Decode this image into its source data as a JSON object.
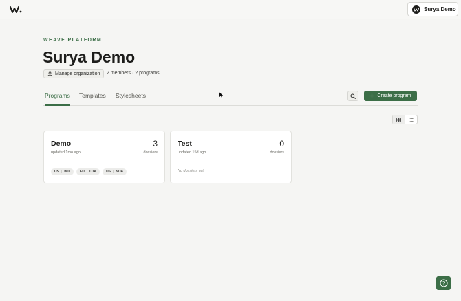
{
  "topbar": {
    "logo_icon": "weave-logo-icon",
    "user_label": "Surya Demo"
  },
  "header": {
    "eyebrow": "WEAVE PLATFORM",
    "title": "Surya Demo",
    "manage_label": "Manage organization",
    "meta": "2 members · 2 programs"
  },
  "tabs": [
    {
      "label": "Programs",
      "active": true
    },
    {
      "label": "Templates",
      "active": false
    },
    {
      "label": "Stylesheets",
      "active": false
    }
  ],
  "actions": {
    "search_icon": "search-icon",
    "create_label": "Create program"
  },
  "view_toggle": {
    "options": [
      "grid-view-icon",
      "list-view-icon"
    ],
    "selected": "grid-view-icon"
  },
  "programs": [
    {
      "name": "Demo",
      "count": "3",
      "updated": "updated 1mo ago",
      "unit": "dossiers",
      "tags": [
        {
          "a": "US",
          "b": "IND"
        },
        {
          "a": "EU",
          "b": "CTA"
        },
        {
          "a": "US",
          "b": "NDA"
        }
      ]
    },
    {
      "name": "Test",
      "count": "0",
      "updated": "updated 15d ago",
      "unit": "dossiers",
      "empty_note": "No dossiers yet"
    }
  ],
  "colors": {
    "accent": "#3c6e47",
    "background": "#f5f5f3",
    "card": "#ffffff"
  }
}
